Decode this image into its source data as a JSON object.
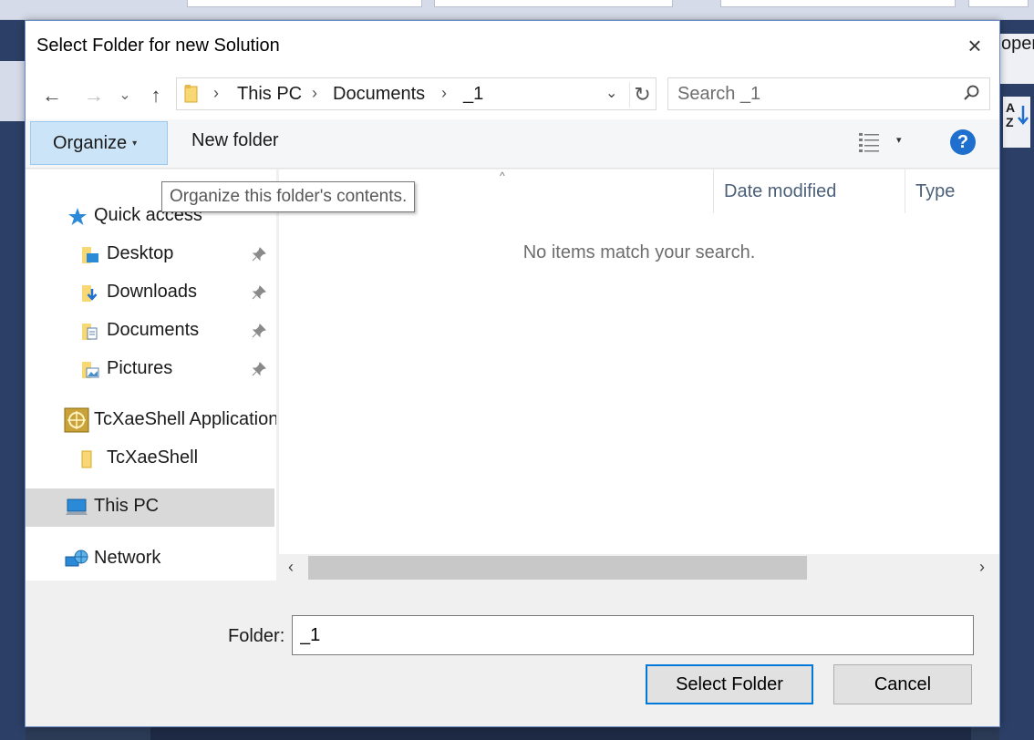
{
  "background": {
    "right_panel_text": "oper"
  },
  "dialog": {
    "title": "Select Folder for new Solution",
    "close_icon": "×"
  },
  "nav": {
    "back_icon": "←",
    "forward_icon": "→",
    "recent_icon": "⌄",
    "up_icon": "↑",
    "breadcrumbs": [
      "This PC",
      "Documents",
      "_1"
    ],
    "separator": "›",
    "dropdown_icon": "⌄",
    "refresh_icon": "↻",
    "search_placeholder": "Search _1"
  },
  "toolbar": {
    "organize_label": "Organize",
    "organize_caret": "▾",
    "new_folder_label": "New folder",
    "view_caret": "▾",
    "help_label": "?"
  },
  "tooltip": {
    "text": "Organize this folder's contents."
  },
  "navpane": {
    "quick_access": "Quick access",
    "items": [
      {
        "label": "Desktop",
        "icon": "desktop-folder-icon"
      },
      {
        "label": "Downloads",
        "icon": "downloads-folder-icon"
      },
      {
        "label": "Documents",
        "icon": "documents-folder-icon"
      },
      {
        "label": "Pictures",
        "icon": "pictures-folder-icon"
      }
    ],
    "app_group": "TcXaeShell Application",
    "app_folder": "TcXaeShell",
    "this_pc": "This PC",
    "network": "Network"
  },
  "content": {
    "sort_indicator": "^",
    "columns": [
      "Date modified",
      "Type"
    ],
    "empty_message": "No items match your search.",
    "scroll_left": "‹",
    "scroll_right": "›"
  },
  "footer": {
    "folder_label": "Folder:",
    "folder_value": "_1",
    "select_button": "Select Folder",
    "cancel_button": "Cancel"
  },
  "colors": {
    "accent": "#0078d7",
    "organize_bg": "#cce4f7",
    "selected_bg": "#d9d9d9",
    "help": "#1f6fce"
  }
}
